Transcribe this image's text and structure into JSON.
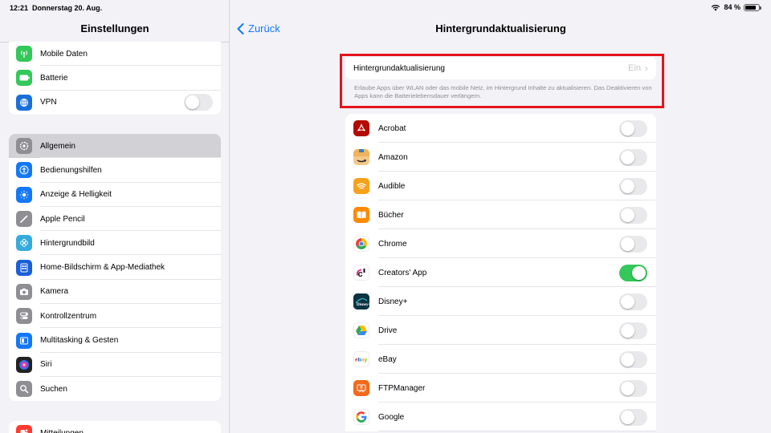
{
  "status": {
    "time": "12:21",
    "date": "Donnerstag 20. Aug.",
    "battery": "84 %",
    "battery_level": 0.84
  },
  "sidebar": {
    "title": "Einstellungen",
    "group1": [
      {
        "label": "Mobile Daten",
        "icon": "antenna-icon",
        "color": "#34c759"
      },
      {
        "label": "Batterie",
        "icon": "battery-icon",
        "color": "#34c759"
      },
      {
        "label": "VPN",
        "icon": "globe-icon",
        "color": "#1a6fd8",
        "toggle": false
      }
    ],
    "group2": [
      {
        "label": "Allgemein",
        "icon": "gear-icon",
        "color": "#8e8e93",
        "active": true
      },
      {
        "label": "Bedienungshilfen",
        "icon": "accessibility-icon",
        "color": "#1478f6"
      },
      {
        "label": "Anzeige & Helligkeit",
        "icon": "sun-icon",
        "color": "#1478f6"
      },
      {
        "label": "Apple Pencil",
        "icon": "pencil-icon",
        "color": "#8e8e93"
      },
      {
        "label": "Hintergrundbild",
        "icon": "flower-icon",
        "color": "#35aadc"
      },
      {
        "label": "Home-Bildschirm & App-Mediathek",
        "icon": "home-screen-icon",
        "color": "#1a5fd8"
      },
      {
        "label": "Kamera",
        "icon": "camera-icon",
        "color": "#8e8e93"
      },
      {
        "label": "Kontrollzentrum",
        "icon": "switches-icon",
        "color": "#8e8e93"
      },
      {
        "label": "Multitasking & Gesten",
        "icon": "multitasking-icon",
        "color": "#1478f6"
      },
      {
        "label": "Siri",
        "icon": "siri-icon",
        "color": "#222222"
      },
      {
        "label": "Suchen",
        "icon": "search-icon",
        "color": "#8e8e93"
      }
    ],
    "group3": [
      {
        "label": "Mitteilungen",
        "icon": "notifications-icon",
        "color": "#ff3b30"
      }
    ]
  },
  "main": {
    "back_label": "Zurück",
    "title": "Hintergrundaktualisierung",
    "setting": {
      "label": "Hintergrundaktualisierung",
      "value": "Ein",
      "description": "Erlaube Apps über WLAN oder das mobile Netz, im Hintergrund Inhalte zu aktualisieren. Das Deaktivieren von Apps kann die Batterielebensdauer verlängern."
    },
    "highlight_color": "#e5141c",
    "apps": [
      {
        "name": "Acrobat",
        "icon": "acrobat-icon",
        "on": false
      },
      {
        "name": "Amazon",
        "icon": "amazon-icon",
        "on": false
      },
      {
        "name": "Audible",
        "icon": "audible-icon",
        "on": false
      },
      {
        "name": "Bücher",
        "icon": "books-icon",
        "on": false
      },
      {
        "name": "Chrome",
        "icon": "chrome-icon",
        "on": false
      },
      {
        "name": "Creators' App",
        "icon": "creators-app-icon",
        "on": true
      },
      {
        "name": "Disney+",
        "icon": "disney-plus-icon",
        "on": false
      },
      {
        "name": "Drive",
        "icon": "drive-icon",
        "on": false
      },
      {
        "name": "eBay",
        "icon": "ebay-icon",
        "on": false
      },
      {
        "name": "FTPManager",
        "icon": "ftp-manager-icon",
        "on": false
      },
      {
        "name": "Google",
        "icon": "google-icon",
        "on": false
      }
    ]
  }
}
